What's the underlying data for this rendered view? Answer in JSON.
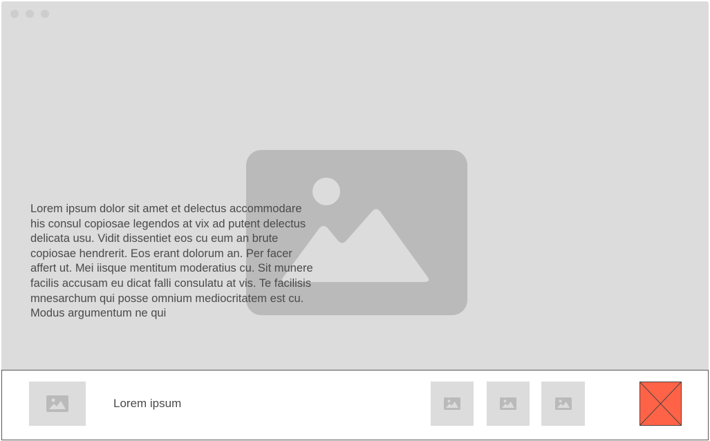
{
  "window": {
    "controls": [
      "window-dot",
      "window-dot",
      "window-dot"
    ]
  },
  "hero": {
    "icon": "image-placeholder-icon"
  },
  "content": {
    "paragraph": "Lorem ipsum dolor sit amet et delectus accommodare his consul copiosae legendos at vix ad putent delectus delicata usu. Vidit dissentiet eos cu eum an brute copiosae hendrerit. Eos erant dolorum an. Per facer affert ut. Mei iisque mentitum moderatius cu. Sit munere facilis accusam eu dicat falli consulatu at vis. Te facilisis mnesarchum qui posse omnium mediocritatem est cu. Modus argumentum ne qui"
  },
  "bottom_bar": {
    "label": "Lorem ipsum",
    "thumbnail_icon": "image-placeholder-icon",
    "thumbnails_count": 3,
    "close_icon": "close-x-icon"
  },
  "colors": {
    "window_bg": "#dcdcdc",
    "image_placeholder": "#bababa",
    "close_button": "#ff6347",
    "text": "#4a4a4a"
  }
}
